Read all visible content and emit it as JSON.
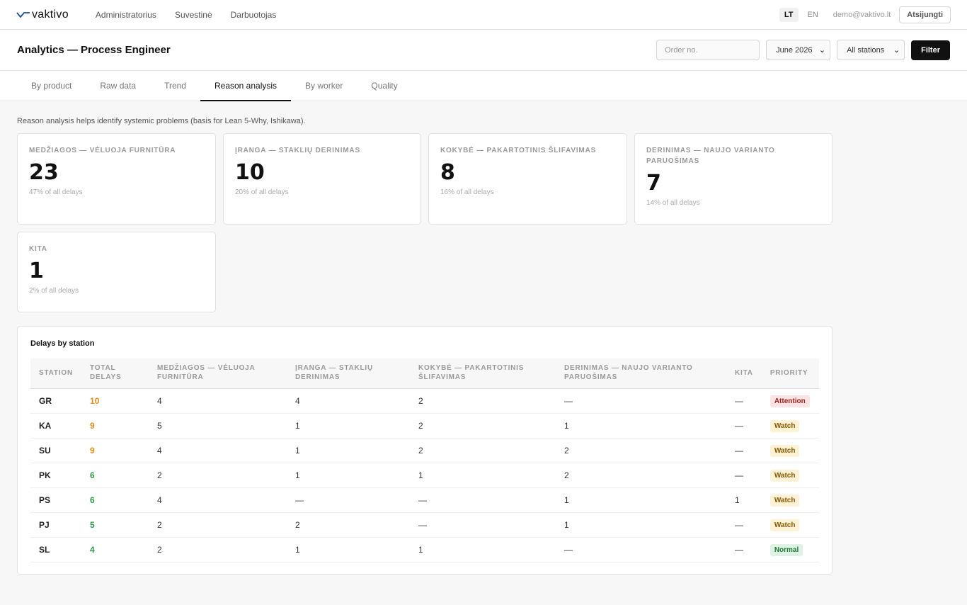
{
  "brand": {
    "name": "vaktivo"
  },
  "nav": {
    "items": [
      "Administratorius",
      "Suvestinė",
      "Darbuotojas"
    ]
  },
  "lang": {
    "lt": "LT",
    "en": "EN"
  },
  "user": {
    "email": "demo@vaktivo.lt",
    "logout": "Atsijungti"
  },
  "page": {
    "title": "Analytics — Process Engineer"
  },
  "filters": {
    "order_placeholder": "Order no.",
    "month": "June 2026",
    "station": "All stations",
    "filter_button": "Filter"
  },
  "tabs": [
    {
      "label": "By product"
    },
    {
      "label": "Raw data"
    },
    {
      "label": "Trend"
    },
    {
      "label": "Reason analysis",
      "active": true
    },
    {
      "label": "By worker"
    },
    {
      "label": "Quality"
    }
  ],
  "hint": "Reason analysis helps identify systemic problems (basis for Lean 5-Why, Ishikawa).",
  "cards": [
    {
      "label": "Medžiagos — vėluoja furnitūra",
      "value": "23",
      "pct": "47% of all delays"
    },
    {
      "label": "Įranga — staklių derinimas",
      "value": "10",
      "pct": "20% of all delays"
    },
    {
      "label": "Kokybė — pakartotinis šlifavimas",
      "value": "8",
      "pct": "16% of all delays"
    },
    {
      "label": "Derinimas — naujo varianto paruošimas",
      "value": "7",
      "pct": "14% of all delays"
    },
    {
      "label": "Kita",
      "value": "1",
      "pct": "2% of all delays"
    }
  ],
  "table": {
    "title": "Delays by station",
    "headers": [
      "Station",
      "Total delays",
      "Medžiagos — vėluoja furnitūra",
      "Įranga — staklių derinimas",
      "Kokybė — pakartotinis šlifavimas",
      "Derinimas — naujo varianto paruošimas",
      "Kita",
      "Priority"
    ],
    "rows": [
      {
        "station": "GR",
        "total": "10",
        "total_color": "orange",
        "m": "4",
        "i": "4",
        "k": "2",
        "d": "—",
        "kita": "—",
        "priority": "Attention",
        "priority_type": "attention"
      },
      {
        "station": "KA",
        "total": "9",
        "total_color": "orange",
        "m": "5",
        "i": "1",
        "k": "2",
        "d": "1",
        "kita": "—",
        "priority": "Watch",
        "priority_type": "watch"
      },
      {
        "station": "SU",
        "total": "9",
        "total_color": "orange",
        "m": "4",
        "i": "1",
        "k": "2",
        "d": "2",
        "kita": "—",
        "priority": "Watch",
        "priority_type": "watch"
      },
      {
        "station": "PK",
        "total": "6",
        "total_color": "green",
        "m": "2",
        "i": "1",
        "k": "1",
        "d": "2",
        "kita": "—",
        "priority": "Watch",
        "priority_type": "watch"
      },
      {
        "station": "PS",
        "total": "6",
        "total_color": "green",
        "m": "4",
        "i": "—",
        "k": "—",
        "d": "1",
        "kita": "1",
        "priority": "Watch",
        "priority_type": "watch"
      },
      {
        "station": "PJ",
        "total": "5",
        "total_color": "green",
        "m": "2",
        "i": "2",
        "k": "—",
        "d": "1",
        "kita": "—",
        "priority": "Watch",
        "priority_type": "watch"
      },
      {
        "station": "SL",
        "total": "4",
        "total_color": "green",
        "m": "2",
        "i": "1",
        "k": "1",
        "d": "—",
        "kita": "—",
        "priority": "Normal",
        "priority_type": "normal"
      }
    ]
  },
  "colors": {
    "orange": "#e08c1e",
    "green": "#2b9b48",
    "attention": "#a32020",
    "watch": "#8a5a00",
    "normal": "#1f7a3a"
  }
}
